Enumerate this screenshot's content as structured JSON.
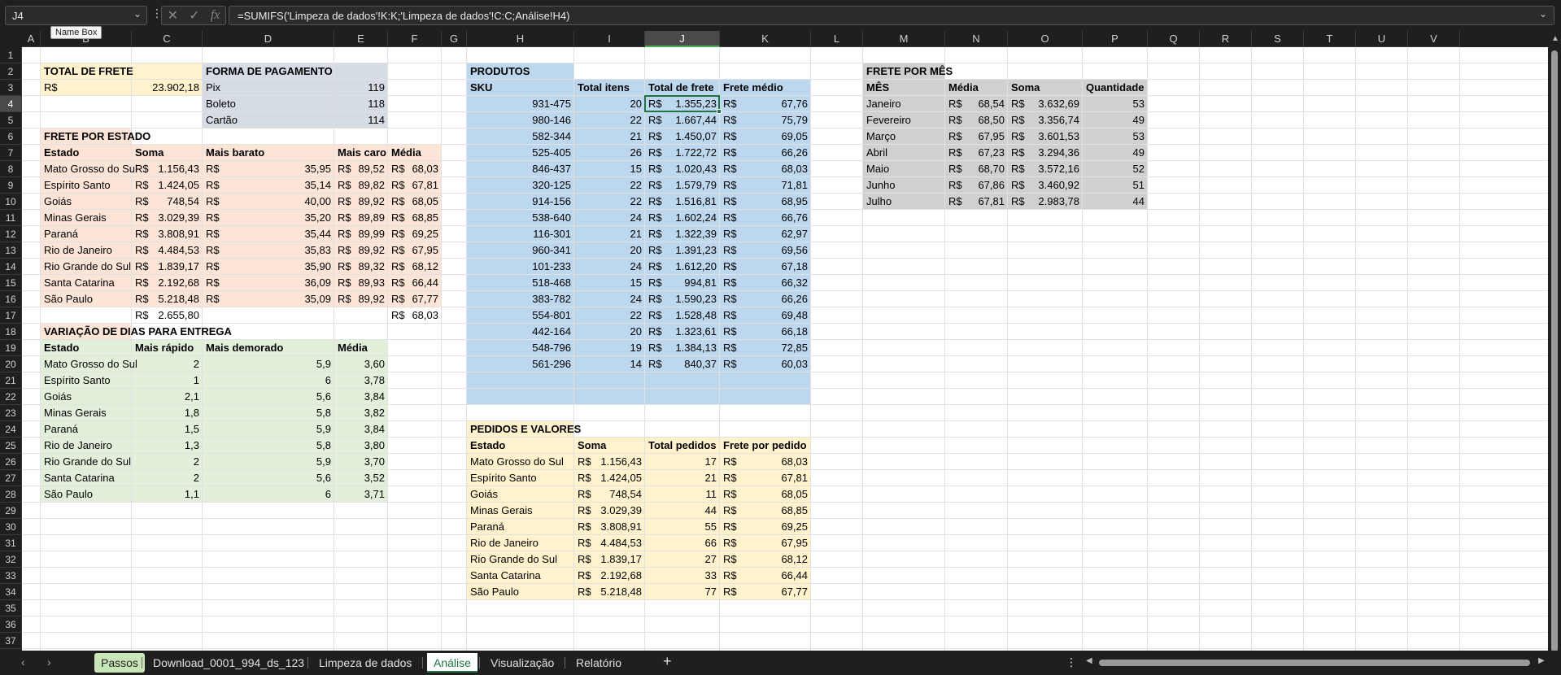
{
  "namebox": {
    "value": "J4",
    "tooltip": "Name Box"
  },
  "formula_bar": {
    "formula": "=SUMIFS('Limpeza de dados'!K:K;'Limpeza de dados'!C:C;Análise!H4)",
    "fx_label": "fx"
  },
  "columns": [
    "A",
    "B",
    "C",
    "D",
    "E",
    "F",
    "G",
    "H",
    "I",
    "J",
    "K",
    "L",
    "M",
    "N",
    "O",
    "P",
    "Q",
    "R",
    "S",
    "T",
    "U",
    "V"
  ],
  "rows": [
    "1",
    "2",
    "3",
    "4",
    "5",
    "6",
    "7",
    "8",
    "9",
    "10",
    "11",
    "12",
    "13",
    "14",
    "15",
    "16",
    "17",
    "18",
    "19",
    "20",
    "21",
    "22",
    "23",
    "24",
    "25",
    "26",
    "27",
    "28",
    "29",
    "30",
    "31",
    "32",
    "33",
    "34",
    "35",
    "36",
    "37"
  ],
  "currency": "R$",
  "total_frete": {
    "title": "TOTAL DE FRETE",
    "value": "23.902,18"
  },
  "forma_pagamento": {
    "title": "FORMA DE PAGAMENTO",
    "rows": [
      [
        "Pix",
        "119"
      ],
      [
        "Boleto",
        "118"
      ],
      [
        "Cartão",
        "114"
      ]
    ]
  },
  "frete_estado": {
    "title": "FRETE POR ESTADO",
    "headers": [
      "Estado",
      "Soma",
      "Mais barato",
      "Mais caro",
      "Média"
    ],
    "rows": [
      [
        "Mato Grosso do Sul",
        "1.156,43",
        "35,95",
        "89,52",
        "68,03"
      ],
      [
        "Espírito Santo",
        "1.424,05",
        "35,14",
        "89,82",
        "67,81"
      ],
      [
        "Goiás",
        "748,54",
        "40,00",
        "89,92",
        "68,05"
      ],
      [
        "Minas Gerais",
        "3.029,39",
        "35,20",
        "89,89",
        "68,85"
      ],
      [
        "Paraná",
        "3.808,91",
        "35,44",
        "89,99",
        "69,25"
      ],
      [
        "Rio de Janeiro",
        "4.484,53",
        "35,83",
        "89,92",
        "67,95"
      ],
      [
        "Rio Grande do Sul",
        "1.839,17",
        "35,90",
        "89,32",
        "68,12"
      ],
      [
        "Santa Catarina",
        "2.192,68",
        "36,09",
        "89,93",
        "66,44"
      ],
      [
        "São Paulo",
        "5.218,48",
        "35,09",
        "89,92",
        "67,77"
      ]
    ],
    "total_soma": "2.655,80",
    "total_media": "68,03"
  },
  "variacao_dias": {
    "title": "VARIAÇÃO DE DIAS PARA ENTREGA",
    "headers": [
      "Estado",
      "Mais rápido",
      "Mais demorado",
      "Média"
    ],
    "rows": [
      [
        "Mato Grosso do Sul",
        "2",
        "5,9",
        "3,60"
      ],
      [
        "Espírito Santo",
        "1",
        "6",
        "3,78"
      ],
      [
        "Goiás",
        "2,1",
        "5,6",
        "3,84"
      ],
      [
        "Minas Gerais",
        "1,8",
        "5,8",
        "3,82"
      ],
      [
        "Paraná",
        "1,5",
        "5,9",
        "3,84"
      ],
      [
        "Rio de Janeiro",
        "1,3",
        "5,8",
        "3,80"
      ],
      [
        "Rio Grande do Sul",
        "2",
        "5,9",
        "3,70"
      ],
      [
        "Santa Catarina",
        "2",
        "5,6",
        "3,52"
      ],
      [
        "São Paulo",
        "1,1",
        "6",
        "3,71"
      ]
    ]
  },
  "produtos": {
    "title": "PRODUTOS",
    "headers": [
      "SKU",
      "Total itens",
      "Total de frete",
      "Frete médio"
    ],
    "rows": [
      [
        "931-475",
        "20",
        "1.355,23",
        "67,76"
      ],
      [
        "980-146",
        "22",
        "1.667,44",
        "75,79"
      ],
      [
        "582-344",
        "21",
        "1.450,07",
        "69,05"
      ],
      [
        "525-405",
        "26",
        "1.722,72",
        "66,26"
      ],
      [
        "846-437",
        "15",
        "1.020,43",
        "68,03"
      ],
      [
        "320-125",
        "22",
        "1.579,79",
        "71,81"
      ],
      [
        "914-156",
        "22",
        "1.516,81",
        "68,95"
      ],
      [
        "538-640",
        "24",
        "1.602,24",
        "66,76"
      ],
      [
        "116-301",
        "21",
        "1.322,39",
        "62,97"
      ],
      [
        "960-341",
        "20",
        "1.391,23",
        "69,56"
      ],
      [
        "101-233",
        "24",
        "1.612,20",
        "67,18"
      ],
      [
        "518-468",
        "15",
        "994,81",
        "66,32"
      ],
      [
        "383-782",
        "24",
        "1.590,23",
        "66,26"
      ],
      [
        "554-801",
        "22",
        "1.528,48",
        "69,48"
      ],
      [
        "442-164",
        "20",
        "1.323,61",
        "66,18"
      ],
      [
        "548-796",
        "19",
        "1.384,13",
        "72,85"
      ],
      [
        "561-296",
        "14",
        "840,37",
        "60,03"
      ]
    ]
  },
  "pedidos_valores": {
    "title": "PEDIDOS E VALORES",
    "headers": [
      "Estado",
      "Soma",
      "Total pedidos",
      "Frete por pedido"
    ],
    "rows": [
      [
        "Mato Grosso do Sul",
        "1.156,43",
        "17",
        "68,03"
      ],
      [
        "Espírito Santo",
        "1.424,05",
        "21",
        "67,81"
      ],
      [
        "Goiás",
        "748,54",
        "11",
        "68,05"
      ],
      [
        "Minas Gerais",
        "3.029,39",
        "44",
        "68,85"
      ],
      [
        "Paraná",
        "3.808,91",
        "55",
        "69,25"
      ],
      [
        "Rio de Janeiro",
        "4.484,53",
        "66",
        "67,95"
      ],
      [
        "Rio Grande do Sul",
        "1.839,17",
        "27",
        "68,12"
      ],
      [
        "Santa Catarina",
        "2.192,68",
        "33",
        "66,44"
      ],
      [
        "São Paulo",
        "5.218,48",
        "77",
        "67,77"
      ]
    ]
  },
  "frete_mes": {
    "title": "FRETE POR MÊS",
    "headers": [
      "MÊS",
      "Média",
      "Soma",
      "Quantidade"
    ],
    "rows": [
      [
        "Janeiro",
        "68,54",
        "3.632,69",
        "53"
      ],
      [
        "Fevereiro",
        "68,50",
        "3.356,74",
        "49"
      ],
      [
        "Março",
        "67,95",
        "3.601,53",
        "53"
      ],
      [
        "Abril",
        "67,23",
        "3.294,36",
        "49"
      ],
      [
        "Maio",
        "68,70",
        "3.572,16",
        "52"
      ],
      [
        "Junho",
        "67,86",
        "3.460,92",
        "51"
      ],
      [
        "Julho",
        "67,81",
        "2.983,78",
        "44"
      ]
    ]
  },
  "sheet_tabs": [
    "Passos",
    "Download_0001_994_ds_123",
    "Limpeza de dados",
    "Análise",
    "Visualização",
    "Relatório"
  ],
  "active_tab": "Análise",
  "colors": {
    "yellow": "#fff2cc",
    "peach": "#fce4d6",
    "slate": "#d6dce4",
    "blue": "#bdd7ee",
    "green": "#e2efda",
    "gray": "#d0d0d0",
    "accent": "#217346"
  }
}
